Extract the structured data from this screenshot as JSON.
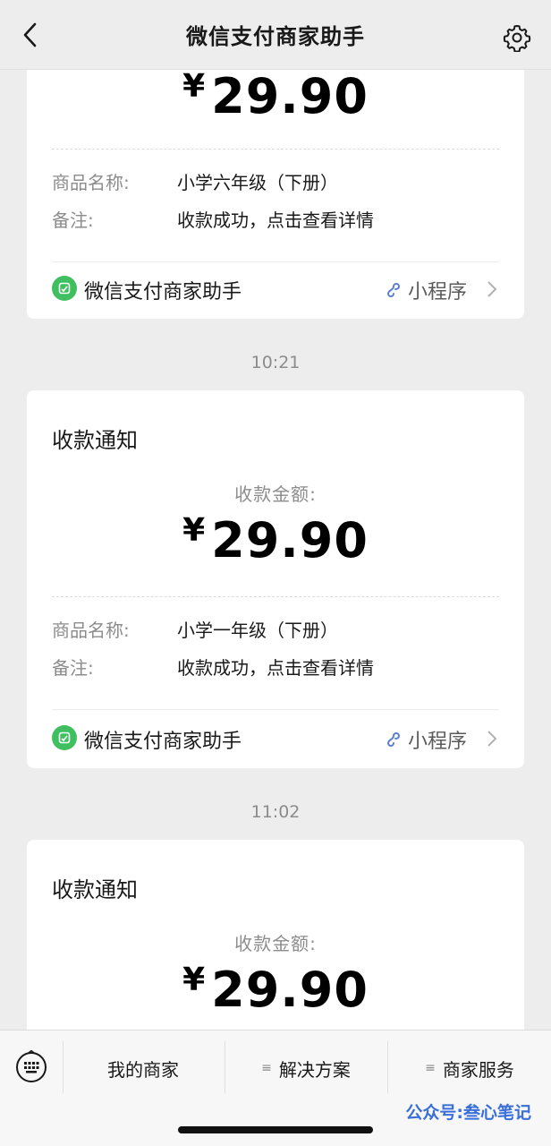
{
  "header": {
    "title": "微信支付商家助手",
    "back_icon": "chevron-left-icon",
    "settings_icon": "gear-icon"
  },
  "cards": [
    {
      "amount": "29.90",
      "currency": "¥",
      "rows": [
        {
          "key": "商品名称:",
          "value": "小学六年级（下册）"
        },
        {
          "key": "备注:",
          "value": "收款成功，点击查看详情"
        }
      ],
      "footer_name": "微信支付商家助手",
      "footer_link": "小程序"
    },
    {
      "notice": "收款通知",
      "amount_label": "收款金额:",
      "amount": "29.90",
      "currency": "¥",
      "rows": [
        {
          "key": "商品名称:",
          "value": "小学一年级（下册）"
        },
        {
          "key": "备注:",
          "value": "收款成功，点击查看详情"
        }
      ],
      "footer_name": "微信支付商家助手",
      "footer_link": "小程序"
    },
    {
      "notice": "收款通知",
      "amount_label": "收款金额:",
      "amount": "29.90",
      "currency": "¥"
    }
  ],
  "timestamps": [
    "10:21",
    "11:02"
  ],
  "bottom_menu": {
    "keyboard_icon": "keyboard-icon",
    "items": [
      {
        "label": "我的商家"
      },
      {
        "label": "解决方案",
        "icon": "≡"
      },
      {
        "label": "商家服务",
        "icon": "≡"
      }
    ]
  },
  "watermark": "公众号:叁心笔记",
  "colors": {
    "background": "#ededed",
    "card": "#ffffff",
    "badge_green": "#3fbf60",
    "mini_blue": "#5b7fd6",
    "watermark_blue": "#3a6fd8"
  }
}
